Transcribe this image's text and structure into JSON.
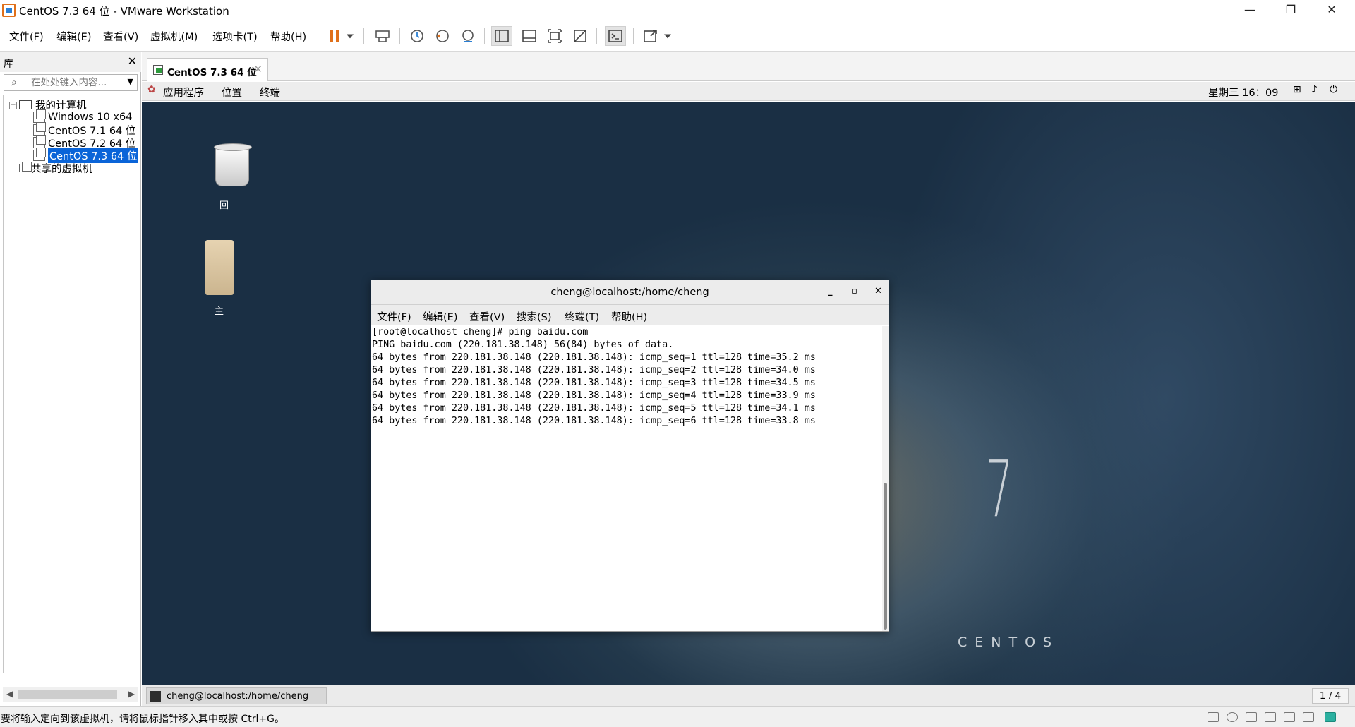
{
  "window": {
    "title": "CentOS 7.3 64 位 - VMware Workstation",
    "controls": {
      "minimize": "—",
      "restore": "❐",
      "close": "✕"
    }
  },
  "menu": {
    "items": [
      "文件(F)",
      "编辑(E)",
      "查看(V)",
      "虚拟机(M)",
      "选项卡(T)",
      "帮助(H)"
    ]
  },
  "toolbar": {
    "buttons": [
      "pause-icon",
      "dropdown-arrow-icon",
      "send-ctrl-alt-del-icon",
      "snapshot-icon",
      "revert-snapshot-icon",
      "snapshot-manager-icon",
      "show-library-icon",
      "thumbnail-bar-icon",
      "full-screen-icon",
      "unity-icon",
      "console-view-icon",
      "stretch-guest-icon"
    ],
    "accent_color": "#e0701a"
  },
  "library": {
    "title": "库",
    "close": "✕",
    "search_placeholder": "在处处键入内容...",
    "tree": {
      "root": "我的计算机",
      "vms": [
        "Windows 10 x64",
        "CentOS 7.1 64 位",
        "CentOS 7.2 64 位",
        "CentOS 7.3 64 位"
      ],
      "selected": "CentOS 7.3 64 位",
      "shared": "共享的虚拟机"
    }
  },
  "vm_tab": {
    "label": "CentOS 7.3 64 位",
    "close": "✕"
  },
  "gnome_bar": {
    "menus": [
      "应用程序",
      "位置",
      "终端"
    ],
    "clock": "星期三 16：09"
  },
  "desktop": {
    "trash_label": "回",
    "home_label": "主",
    "brand_number": "7",
    "brand_name": "CENTOS"
  },
  "terminal": {
    "title": "cheng@localhost:/home/cheng",
    "menus": [
      "文件(F)",
      "编辑(E)",
      "查看(V)",
      "搜索(S)",
      "终端(T)",
      "帮助(H)"
    ],
    "lines": [
      "[root@localhost cheng]# ping baidu.com",
      "PING baidu.com (220.181.38.148) 56(84) bytes of data.",
      "64 bytes from 220.181.38.148 (220.181.38.148): icmp_seq=1 ttl=128 time=35.2 ms",
      "64 bytes from 220.181.38.148 (220.181.38.148): icmp_seq=2 ttl=128 time=34.0 ms",
      "64 bytes from 220.181.38.148 (220.181.38.148): icmp_seq=3 ttl=128 time=34.5 ms",
      "64 bytes from 220.181.38.148 (220.181.38.148): icmp_seq=4 ttl=128 time=33.9 ms",
      "64 bytes from 220.181.38.148 (220.181.38.148): icmp_seq=5 ttl=128 time=34.1 ms",
      "64 bytes from 220.181.38.148 (220.181.38.148): icmp_seq=6 ttl=128 time=33.8 ms"
    ]
  },
  "taskbar": {
    "item": "cheng@localhost:/home/cheng",
    "workspace": "1 / 4"
  },
  "statusbar": {
    "message": "要将输入定向到该虚拟机，请将鼠标指针移入其中或按 Ctrl+G。"
  }
}
